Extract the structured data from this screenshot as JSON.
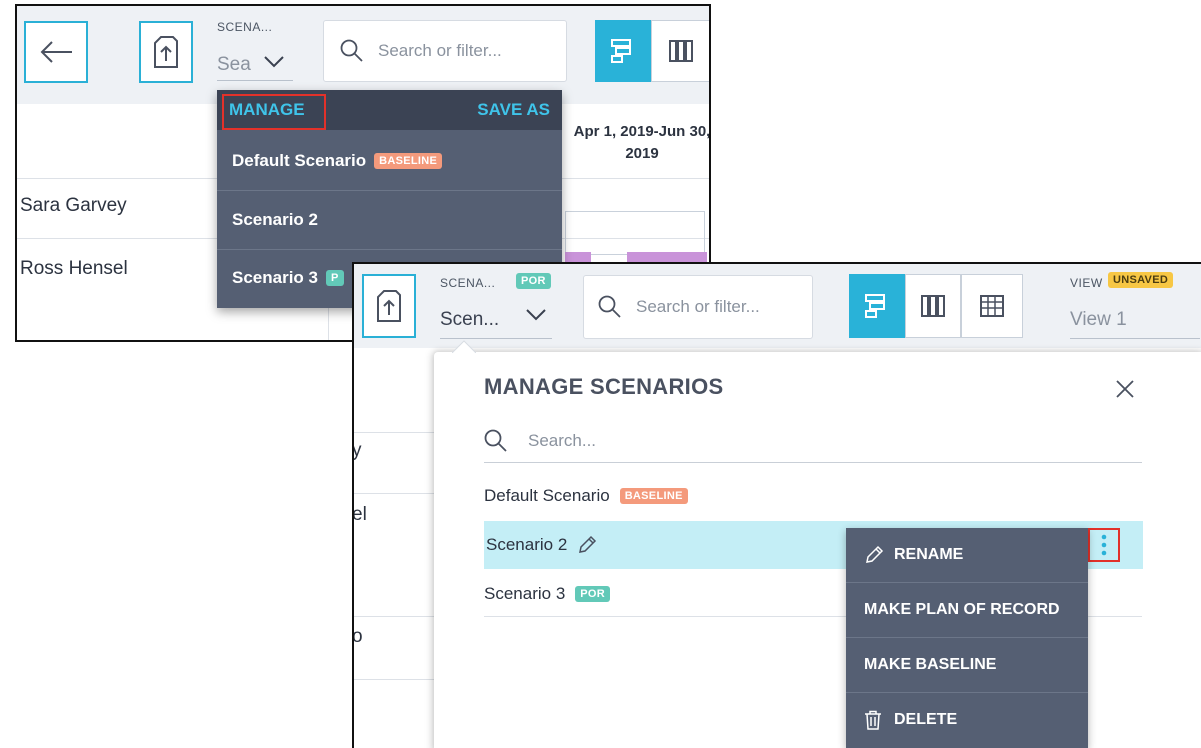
{
  "top_panel": {
    "scenario_label": "SCENA...",
    "scenario_input_value": "Sea",
    "search_placeholder": "Search or filter...",
    "dropdown": {
      "manage_label": "MANAGE",
      "save_as_label": "SAVE AS",
      "items": [
        {
          "label": "Default Scenario",
          "badge": "BASELINE"
        },
        {
          "label": "Scenario 2",
          "badge": ""
        },
        {
          "label": "Scenario 3",
          "badge": "P"
        }
      ]
    },
    "date_header_line1": "Apr 1, 2019-Jun 30,",
    "date_header_line2": "2019",
    "rows": [
      {
        "name": "Sara Garvey"
      },
      {
        "name": "Ross Hensel"
      }
    ]
  },
  "bottom_panel": {
    "scenario_label": "SCENA...",
    "scenario_badge": "POR",
    "scenario_value": "Scen...",
    "search_placeholder": "Search or filter...",
    "view_label": "VIEW",
    "view_badge": "UNSAVED",
    "view_value": "View 1",
    "row_fragments": [
      "y",
      "el",
      "o"
    ],
    "manage_dialog": {
      "title": "MANAGE SCENARIOS",
      "search_placeholder": "Search...",
      "scenarios": [
        {
          "label": "Default Scenario",
          "badge": "BASELINE"
        },
        {
          "label": "Scenario 2",
          "badge": ""
        },
        {
          "label": "Scenario 3",
          "badge": "POR"
        }
      ],
      "context_menu": [
        {
          "label": "RENAME",
          "icon": "pencil-icon"
        },
        {
          "label": "MAKE PLAN OF RECORD",
          "icon": ""
        },
        {
          "label": "MAKE BASELINE",
          "icon": ""
        },
        {
          "label": "DELETE",
          "icon": "trash-icon"
        }
      ]
    }
  },
  "colors": {
    "accent": "#29b2d8",
    "dropdown_bg": "#555f73",
    "highlight_row": "#c4eef6",
    "baseline_badge": "#f49a7c",
    "por_badge": "#62c9b8",
    "unsaved_badge": "#f7c744",
    "callout_red": "#e2312a"
  }
}
